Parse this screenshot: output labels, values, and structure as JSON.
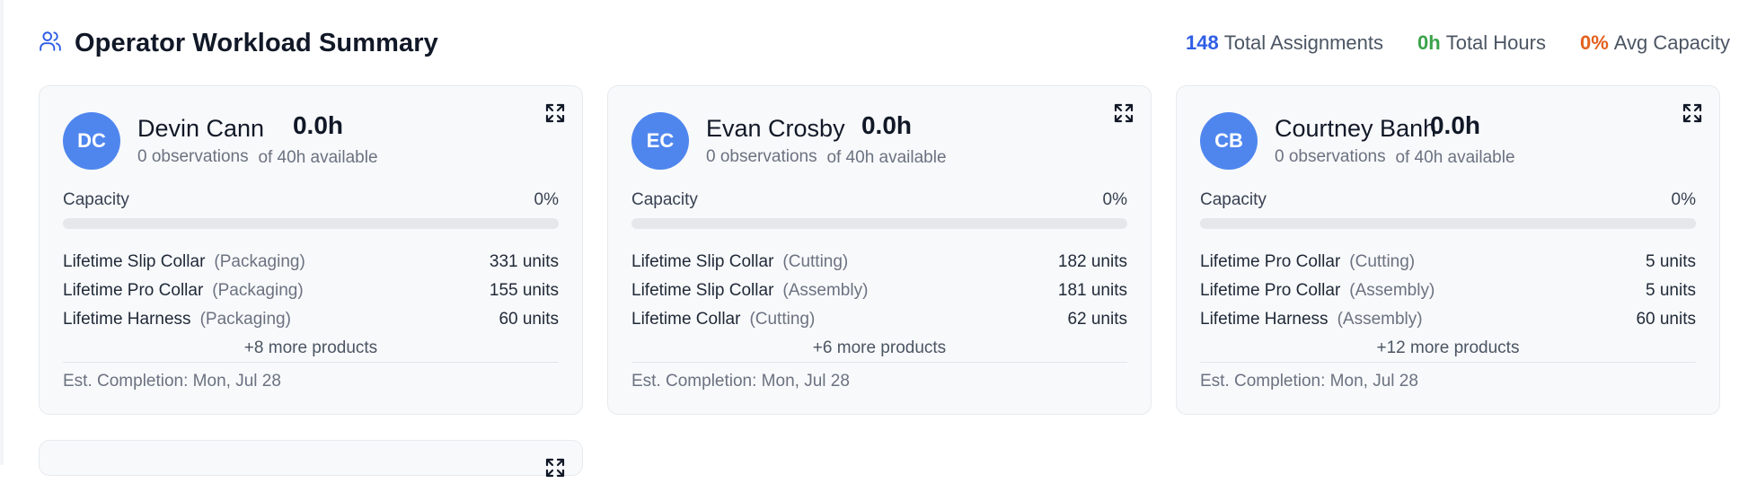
{
  "header": {
    "title": "Operator Workload Summary",
    "icon": "users-icon",
    "stats": [
      {
        "value": "148",
        "label": "Total Assignments",
        "color": "#2f5ee6"
      },
      {
        "value": "0h",
        "label": "Total Hours",
        "color": "#3aa34a"
      },
      {
        "value": "0%",
        "label": "Avg Capacity",
        "color": "#e2601e"
      }
    ]
  },
  "operators": [
    {
      "initials": "DC",
      "name": "Devin Cann",
      "observations": "0 observations",
      "hours": "0.0h",
      "available": "of 40h available",
      "capacity_label": "Capacity",
      "capacity_value": "0%",
      "capacity_fraction": 0,
      "products": [
        {
          "name": "Lifetime Slip Collar",
          "category": "(Packaging)",
          "units": "331 units"
        },
        {
          "name": "Lifetime Pro Collar",
          "category": "(Packaging)",
          "units": "155 units"
        },
        {
          "name": "Lifetime Harness",
          "category": "(Packaging)",
          "units": "60 units"
        }
      ],
      "more": "+8 more products",
      "est_completion": "Est. Completion: Mon, Jul 28"
    },
    {
      "initials": "EC",
      "name": "Evan Crosby",
      "observations": "0 observations",
      "hours": "0.0h",
      "available": "of 40h available",
      "capacity_label": "Capacity",
      "capacity_value": "0%",
      "capacity_fraction": 0,
      "products": [
        {
          "name": "Lifetime Slip Collar",
          "category": "(Cutting)",
          "units": "182 units"
        },
        {
          "name": "Lifetime Slip Collar",
          "category": "(Assembly)",
          "units": "181 units"
        },
        {
          "name": "Lifetime Collar",
          "category": "(Cutting)",
          "units": "62 units"
        }
      ],
      "more": "+6 more products",
      "est_completion": "Est. Completion: Mon, Jul 28"
    },
    {
      "initials": "CB",
      "name": "Courtney Banh",
      "observations": "0 observations",
      "hours": "0.0h",
      "available": "of 40h available",
      "capacity_label": "Capacity",
      "capacity_value": "0%",
      "capacity_fraction": 0,
      "products": [
        {
          "name": "Lifetime Pro Collar",
          "category": "(Cutting)",
          "units": "5 units"
        },
        {
          "name": "Lifetime Pro Collar",
          "category": "(Assembly)",
          "units": "5 units"
        },
        {
          "name": "Lifetime Harness",
          "category": "(Assembly)",
          "units": "60 units"
        }
      ],
      "more": "+12 more products",
      "est_completion": "Est. Completion: Mon, Jul 28"
    }
  ]
}
